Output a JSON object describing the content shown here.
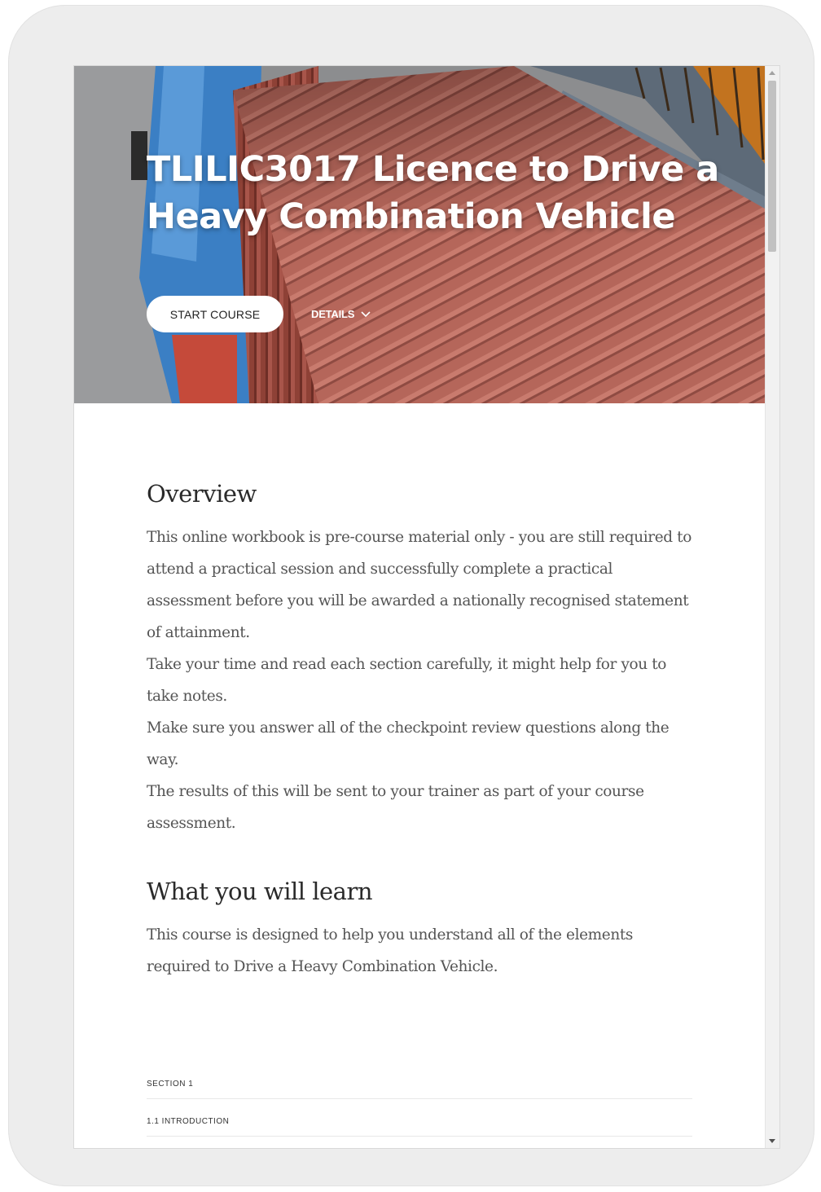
{
  "hero": {
    "title": "TLILIC3017 Licence to Drive a Heavy Combination Vehicle",
    "start_button": "START COURSE",
    "details_button": "DETAILS",
    "details_icon": "chevron-down-icon"
  },
  "overview": {
    "heading": "Overview",
    "paragraphs": [
      "This online workbook is pre-course material only - you are still required to attend a practical session and successfully complete a practical assessment before you will be awarded a nationally recognised statement of attainment.",
      "Take your time and read each section carefully, it might help for you to take notes.",
      "Make sure you answer all of the checkpoint review questions along the way.",
      "The results of this will be sent to your trainer as part of your course assessment."
    ]
  },
  "learn": {
    "heading": "What you will learn",
    "text": "This course is designed to help you understand all of the elements required to Drive a Heavy Combination Vehicle."
  },
  "lessons": {
    "section_label": "SECTION 1",
    "items": [
      "1.1 INTRODUCTION"
    ]
  },
  "colors": {
    "container_red": "#b5665a",
    "cab_blue": "#3b7fc4",
    "device_frame": "#ededed"
  }
}
